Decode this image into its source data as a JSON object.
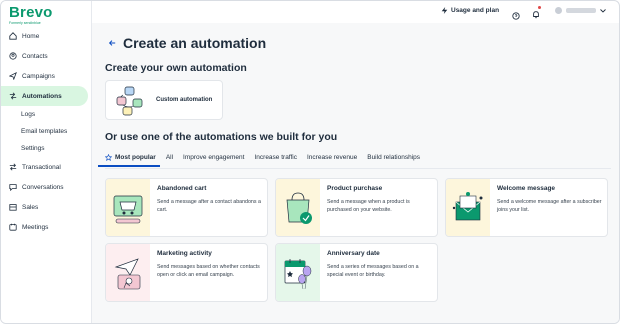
{
  "brand": {
    "name": "Brevo",
    "tagline": "Formerly sendinblue"
  },
  "sidebar": {
    "items": [
      {
        "label": "Home",
        "icon": "home-icon"
      },
      {
        "label": "Contacts",
        "icon": "contacts-icon"
      },
      {
        "label": "Campaigns",
        "icon": "send-icon"
      },
      {
        "label": "Automations",
        "icon": "automation-icon",
        "active": true
      },
      {
        "label": "Logs",
        "sub": true
      },
      {
        "label": "Email templates",
        "sub": true
      },
      {
        "label": "Settings",
        "sub": true
      },
      {
        "label": "Transactional",
        "icon": "transactional-icon"
      },
      {
        "label": "Conversations",
        "icon": "chat-icon"
      },
      {
        "label": "Sales",
        "icon": "sales-icon"
      },
      {
        "label": "Meetings",
        "icon": "calendar-icon"
      }
    ]
  },
  "topbar": {
    "usage_label": "Usage and plan"
  },
  "page": {
    "title": "Create an automation",
    "own_title": "Create your own automation",
    "custom_label": "Custom automation",
    "builtin_title": "Or use one of the automations we built for you"
  },
  "tabs": [
    {
      "label": "Most popular",
      "active": true
    },
    {
      "label": "All"
    },
    {
      "label": "Improve engagement"
    },
    {
      "label": "Increase traffic"
    },
    {
      "label": "Increase revenue"
    },
    {
      "label": "Build relationships"
    }
  ],
  "cards": [
    {
      "title": "Abandoned cart",
      "desc": "Send a message after a contact abandons a cart."
    },
    {
      "title": "Product purchase",
      "desc": "Send a message when a product is purchased on your website."
    },
    {
      "title": "Welcome message",
      "desc": "Send a welcome message after a subscriber joins your list."
    },
    {
      "title": "Marketing activity",
      "desc": "Send messages based on whether contacts open or click an email campaign."
    },
    {
      "title": "Anniversary date",
      "desc": "Send a series of messages based on a special event or birthday."
    }
  ],
  "colors": {
    "brand_green": "#0b996e",
    "active_nav_bg": "#d9f6e1",
    "tab_underline": "#0b4dc2",
    "illu_green": "#e5f7ea",
    "illu_yellow": "#fdf6dc",
    "illu_pink": "#fdeef0"
  }
}
